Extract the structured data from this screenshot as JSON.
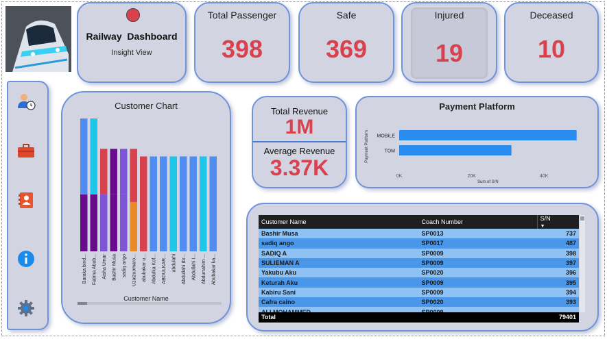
{
  "header": {
    "title": "Railway  Dashboard",
    "subtitle": "Insight View"
  },
  "kpis": [
    {
      "label": "Total Passenger",
      "value": "398"
    },
    {
      "label": "Safe",
      "value": "369"
    },
    {
      "label": "Injured",
      "value": "19"
    },
    {
      "label": "Deceased",
      "value": "10"
    }
  ],
  "revenue": {
    "total_label": "Total Revenue",
    "total_value": "1M",
    "avg_label": "Average Revenue",
    "avg_value": "3.37K"
  },
  "sidebar": {
    "items": [
      {
        "icon": "user-clock-icon"
      },
      {
        "icon": "briefcase-icon"
      },
      {
        "icon": "contact-book-icon"
      },
      {
        "icon": "info-icon"
      },
      {
        "icon": "gear-icon"
      }
    ]
  },
  "colors": {
    "accent_red": "#d7424e",
    "card_bg": "#d2d4e2",
    "card_border": "#6f93da",
    "bar_blue": "#2b8cf0"
  },
  "chart_data": [
    {
      "type": "bar",
      "title": "Customer Chart",
      "xlabel": "Customer Name",
      "ylabel": "",
      "categories": [
        "Baraka bind...",
        "Fatima Abub...",
        "Aisha Umar",
        "Bashir Musa",
        "sadiq ango",
        "Uzaizuomaro...",
        "abubakar u...",
        "Abdulka Kof...",
        "ABDULKAR...",
        "abdulahi",
        "Abdullahi Ibr...",
        "Abdullahi I...",
        "Abdurrahim ...",
        "Abubakar ka..."
      ],
      "segments": [
        [
          {
            "value": 1.5,
            "color": "#680c8b"
          },
          {
            "value": 2.0,
            "color": "#4f8ef0"
          }
        ],
        [
          {
            "value": 1.5,
            "color": "#680c8b"
          },
          {
            "value": 2.0,
            "color": "#1ec6ea"
          }
        ],
        [
          {
            "value": 1.5,
            "color": "#7e55d6"
          },
          {
            "value": 1.2,
            "color": "#d7424e"
          }
        ],
        [
          {
            "value": 1.5,
            "color": "#680c8b"
          },
          {
            "value": 1.2,
            "color": "#680c8b"
          }
        ],
        [
          {
            "value": 1.5,
            "color": "#7e55d6"
          },
          {
            "value": 1.2,
            "color": "#7e55d6"
          }
        ],
        [
          {
            "value": 1.3,
            "color": "#e98a2a"
          },
          {
            "value": 1.4,
            "color": "#d7424e"
          }
        ],
        [
          {
            "value": 2.5,
            "color": "#d7424e"
          }
        ],
        [
          {
            "value": 2.5,
            "color": "#4f8ef0"
          }
        ],
        [
          {
            "value": 2.5,
            "color": "#4f8ef0"
          }
        ],
        [
          {
            "value": 2.5,
            "color": "#1ec6ea"
          }
        ],
        [
          {
            "value": 2.5,
            "color": "#4f8ef0"
          }
        ],
        [
          {
            "value": 2.5,
            "color": "#4f8ef0"
          }
        ],
        [
          {
            "value": 2.5,
            "color": "#1ec6ea"
          }
        ],
        [
          {
            "value": 2.5,
            "color": "#4f8ef0"
          }
        ]
      ],
      "ylim": [
        0,
        3.5
      ],
      "grid": false
    },
    {
      "type": "bar",
      "orientation": "horizontal",
      "title": "Payment Platform",
      "xlabel": "Sum of S/N",
      "ylabel": "Payment Platform",
      "categories": [
        "MOBILE",
        "TOM"
      ],
      "values": [
        49000,
        31000
      ],
      "xticks": [
        "0K",
        "20K",
        "40K"
      ],
      "xlim": [
        0,
        50000
      ]
    },
    {
      "type": "table",
      "columns": [
        "Customer Name",
        "Coach Number",
        "S/N"
      ],
      "rows": [
        [
          "Bashir Musa",
          "SP0013",
          "737"
        ],
        [
          "sadiq ango",
          "SP0017",
          "487"
        ],
        [
          "SADIQ A",
          "SP0009",
          "398"
        ],
        [
          "SULIEMAN A",
          "SP0009",
          "397"
        ],
        [
          "Yakubu Aku",
          "SP0020",
          "396"
        ],
        [
          "Keturah Aku",
          "SP0009",
          "395"
        ],
        [
          "Kabiru Sani",
          "SP0009",
          "394"
        ],
        [
          "Cafra caino",
          "SP0020",
          "393"
        ],
        [
          "ALI MOHAMMED",
          "SP0009",
          ""
        ]
      ],
      "total": [
        "Total",
        "",
        "79401"
      ]
    }
  ]
}
